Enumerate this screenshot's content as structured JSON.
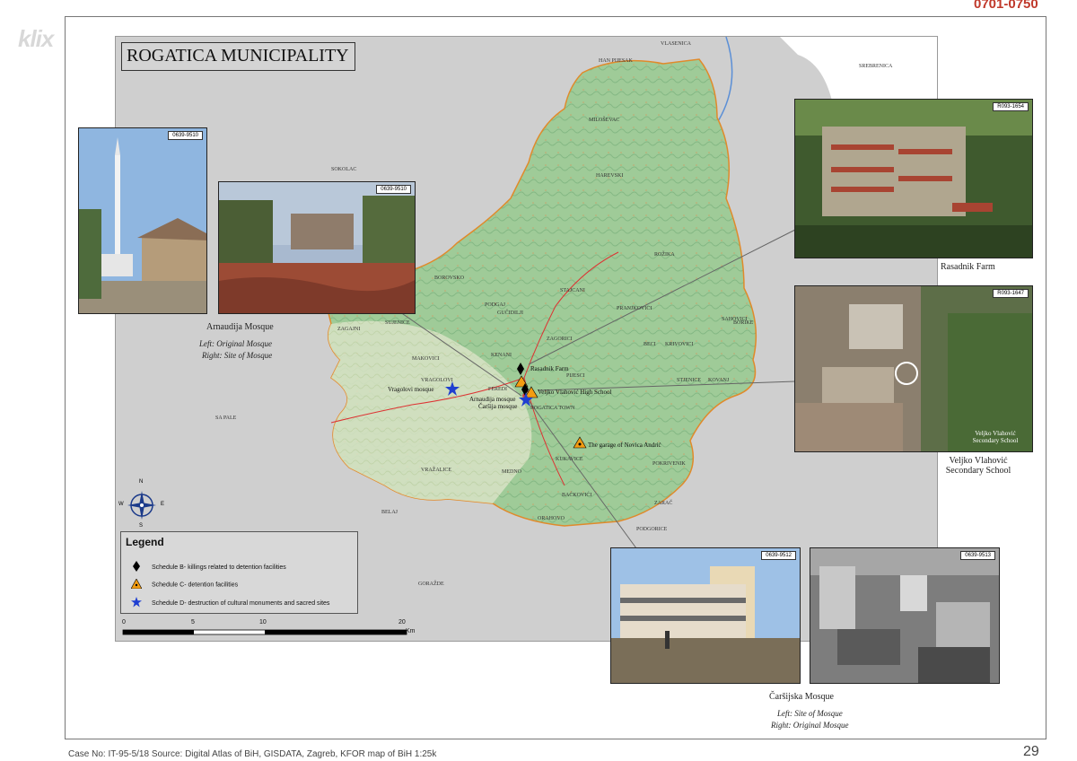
{
  "page": {
    "stamp": "0701-0750",
    "watermark": "klix",
    "footer": "Case No: IT-95-5/18  Source: Digital Atlas of BiH, GISDATA, Zagreb,  KFOR map of BiH 1:25k",
    "page_number": "29"
  },
  "map": {
    "title": "ROGATICA MUNICIPALITY",
    "place_names": [
      "HAN PIJESAK",
      "VLASENICA",
      "SREBRENICA",
      "MILOŠEVAC",
      "HAREVSKI",
      "SOKOLAC",
      "ROŽIKA",
      "BOROVSKO",
      "PODGAJ",
      "GUČIDILJI",
      "SUJENICE",
      "ZAGAJNI",
      "MAKOVICI",
      "KENANI",
      "ZAGORICI",
      "STAJCANI",
      "PRANJKOVICI",
      "BECI",
      "KRIVOVICI",
      "SAHOVICI",
      "STJENICE",
      "KOVANJ",
      "VRAGOLOVI",
      "PIJESCI",
      "FEREDI",
      "ROGATICA TOWN",
      "KUKAVICE",
      "BAĆKOVIĆI",
      "POKRIVENIK",
      "VRAŽALICE",
      "MEDNO",
      "BELAJ",
      "ORAHOVO",
      "ZARAČ",
      "SA PALE",
      "GORAŽDE",
      "PODGORICE",
      "BORIKE"
    ],
    "poi_labels": [
      "Rasadnik Farm",
      "Veljko Vlahović High School",
      "Arnaudija mosque",
      "Čaršija mosque",
      "Vragolovi mosque",
      "The garage of Novica Andrić"
    ],
    "icons": {
      "killing": "black-diamond-icon",
      "detention": "orange-triangle-icon",
      "cultural": "blue-star-icon"
    },
    "colors": {
      "municipality_fill": "#9ccb9a",
      "highland_fill": "#7fbb83",
      "outside": "#cfcfcf",
      "killing": "#000000",
      "detention": "#f39c12",
      "cultural": "#1f3fd1"
    }
  },
  "photos": {
    "p1": {
      "id": "0639-9510"
    },
    "p2": {
      "id": "0639-9510"
    },
    "p3": {
      "id": "R093-1654"
    },
    "p4": {
      "id": "R093-1647"
    },
    "p5": {
      "id": "0639-9512"
    },
    "p6": {
      "id": "0639-9513"
    }
  },
  "captions": {
    "arnaudija": "Arnaudija Mosque",
    "arnaudija_left": "Left: Original Mosque",
    "arnaudija_right": "Right: Site of Mosque",
    "rasadnik": "Rasadnik Farm",
    "veljko_inset": "Veljko Vlahović Secondary School",
    "veljko": "Veljko Vlahović Secondary School",
    "carsijska": "Čaršijska Mosque",
    "carsijska_left": "Left: Site of Mosque",
    "carsijska_right": "Right: Original Mosque"
  },
  "legend": {
    "title": "Legend",
    "items": [
      {
        "icon": "black-diamond-icon",
        "label": "Schedule B- killings related to detention facilities"
      },
      {
        "icon": "orange-triangle-icon",
        "label": "Schedule C- detention facilities"
      },
      {
        "icon": "blue-star-icon",
        "label": "Schedule D- destruction of cultural monuments and sacred sites"
      }
    ]
  },
  "scale": {
    "ticks": [
      "0",
      "5",
      "10",
      "20"
    ],
    "unit": "Km"
  },
  "compass": {
    "n": "N",
    "s": "S",
    "e": "E",
    "w": "W"
  }
}
